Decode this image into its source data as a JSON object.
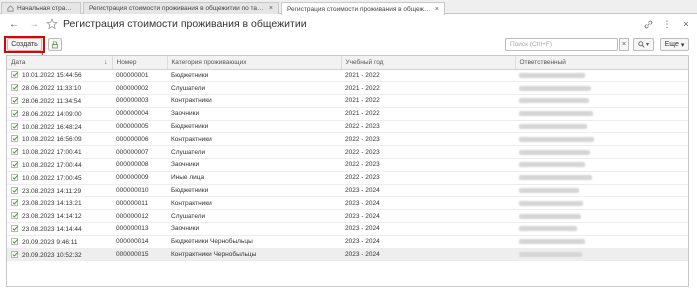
{
  "tabs": [
    {
      "label": "Начальная страница",
      "active": false,
      "closable": false
    },
    {
      "label": "Регистрация стоимости проживания в общежитии по тарифам",
      "active": false,
      "closable": true
    },
    {
      "label": "Регистрация стоимости проживания в общежитии",
      "active": true,
      "closable": true
    }
  ],
  "title": "Регистрация стоимости проживания в общежитии",
  "toolbar": {
    "create_label": "Создать",
    "search_placeholder": "Поиск (Ctrl+F)",
    "clear_glyph": "×",
    "more_label": "Еще"
  },
  "annotation": {
    "number": "1",
    "color": "#e00000"
  },
  "table": {
    "columns": [
      "Дата",
      "Номер",
      "Категория проживающих",
      "Учебный год",
      "Ответственный"
    ],
    "sort_column": "Дата",
    "sort_direction": "descending",
    "selected_row": 14,
    "rows": [
      {
        "date": "10.01.2022 15:44:56",
        "number": "000000001",
        "category": "Бюджетники",
        "year": "2021 - 2022",
        "responsible": ""
      },
      {
        "date": "28.06.2022 11:33:10",
        "number": "000000002",
        "category": "Слушатели",
        "year": "2021 - 2022",
        "responsible": ""
      },
      {
        "date": "28.06.2022 11:34:54",
        "number": "000000003",
        "category": "Контрактники",
        "year": "2021 - 2022",
        "responsible": ""
      },
      {
        "date": "28.06.2022 14:09:00",
        "number": "000000004",
        "category": "Заочники",
        "year": "2021 - 2022",
        "responsible": ""
      },
      {
        "date": "10.08.2022 16:48:24",
        "number": "000000005",
        "category": "Бюджетники",
        "year": "2022 - 2023",
        "responsible": ""
      },
      {
        "date": "10.08.2022 16:56:09",
        "number": "000000006",
        "category": "Контрактники",
        "year": "2022 - 2023",
        "responsible": ""
      },
      {
        "date": "10.08.2022 17:00:41",
        "number": "000000007",
        "category": "Слушатели",
        "year": "2022 - 2023",
        "responsible": ""
      },
      {
        "date": "10.08.2022 17:00:44",
        "number": "000000008",
        "category": "Заочники",
        "year": "2022 - 2023",
        "responsible": ""
      },
      {
        "date": "10.08.2022 17:00:45",
        "number": "000000009",
        "category": "Иные лица",
        "year": "2022 - 2023",
        "responsible": ""
      },
      {
        "date": "23.08.2023 14:11:29",
        "number": "000000010",
        "category": "Бюджетники",
        "year": "2023 - 2024",
        "responsible": ""
      },
      {
        "date": "23.08.2023 14:13:21",
        "number": "000000011",
        "category": "Контрактники",
        "year": "2023 - 2024",
        "responsible": ""
      },
      {
        "date": "23.08.2023 14:14:12",
        "number": "000000012",
        "category": "Слушатели",
        "year": "2023 - 2024",
        "responsible": ""
      },
      {
        "date": "23.08.2023 14:14:44",
        "number": "000000013",
        "category": "Заочники",
        "year": "2023 - 2024",
        "responsible": ""
      },
      {
        "date": "20.09.2023 9:46:11",
        "number": "000000014",
        "category": "Бюджетники Чернобыльцы",
        "year": "2023 - 2024",
        "responsible": ""
      },
      {
        "date": "20.09.2023 10:52:32",
        "number": "000000015",
        "category": "Контрактники Чернобыльцы",
        "year": "2023 - 2024",
        "responsible": ""
      }
    ]
  }
}
